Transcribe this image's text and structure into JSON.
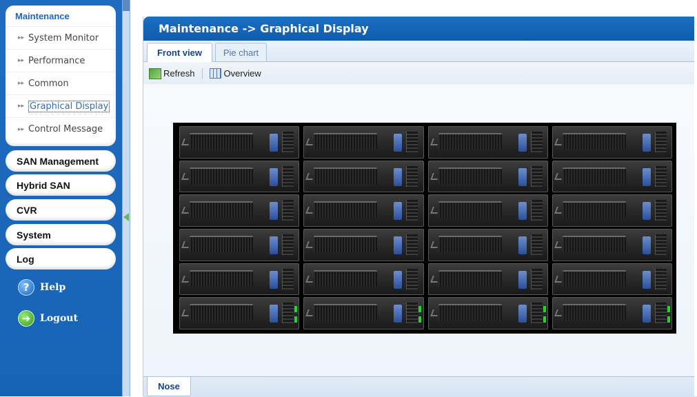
{
  "sidebar": {
    "section_title": "Maintenance",
    "items": [
      {
        "label": "System Monitor"
      },
      {
        "label": "Performance"
      },
      {
        "label": "Common"
      },
      {
        "label": "Graphical Display"
      },
      {
        "label": "Control Message"
      }
    ],
    "sections": [
      {
        "label": "SAN Management"
      },
      {
        "label": "Hybrid SAN"
      },
      {
        "label": "CVR"
      },
      {
        "label": "System"
      },
      {
        "label": "Log"
      }
    ],
    "help_label": "Help",
    "help_icon": "?",
    "logout_label": "Logout",
    "logout_icon": "➜"
  },
  "main": {
    "title": "Maintenance -> Graphical Display",
    "tabs": [
      {
        "label": "Front view",
        "active": true
      },
      {
        "label": "Pie chart",
        "active": false
      }
    ],
    "toolbar": {
      "refresh_label": "Refresh",
      "overview_label": "Overview"
    },
    "chassis": {
      "columns": 4,
      "rows": 6,
      "active_led_row": 6
    },
    "bottom_tab": "Nose"
  },
  "colors": {
    "sidebar_bg": "#1a68ba",
    "title_bar": "#1567bd",
    "led_green": "#2dd12d",
    "latch_blue": "#2a4f9c"
  }
}
